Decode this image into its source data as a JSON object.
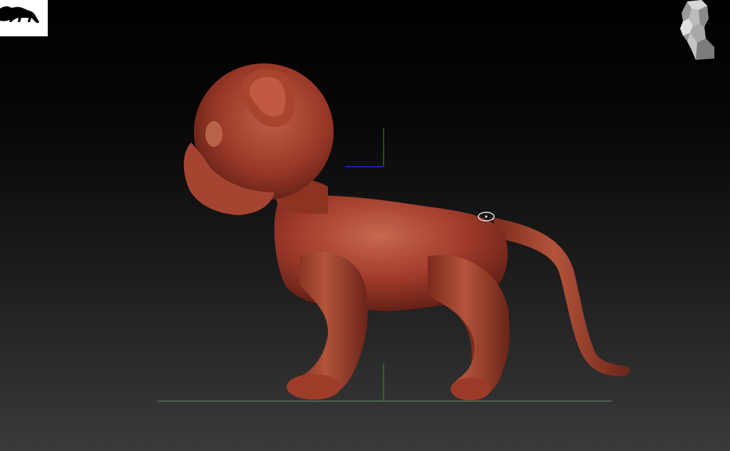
{
  "viewport": {
    "background_top": "#000000",
    "background_bottom": "#3a3a3a"
  },
  "model": {
    "material_color": "#9e3a2a",
    "highlight_color": "#c8684f",
    "shadow_color": "#5a1c12"
  },
  "reference_thumbnail": {
    "icon": "cat-silhouette-icon"
  },
  "navigation": {
    "icon": "head-navigation-icon"
  },
  "axes": {
    "y_color": "#2a9a2a",
    "x_color": "#2626c0",
    "floor_color": "#6a8a6a"
  }
}
